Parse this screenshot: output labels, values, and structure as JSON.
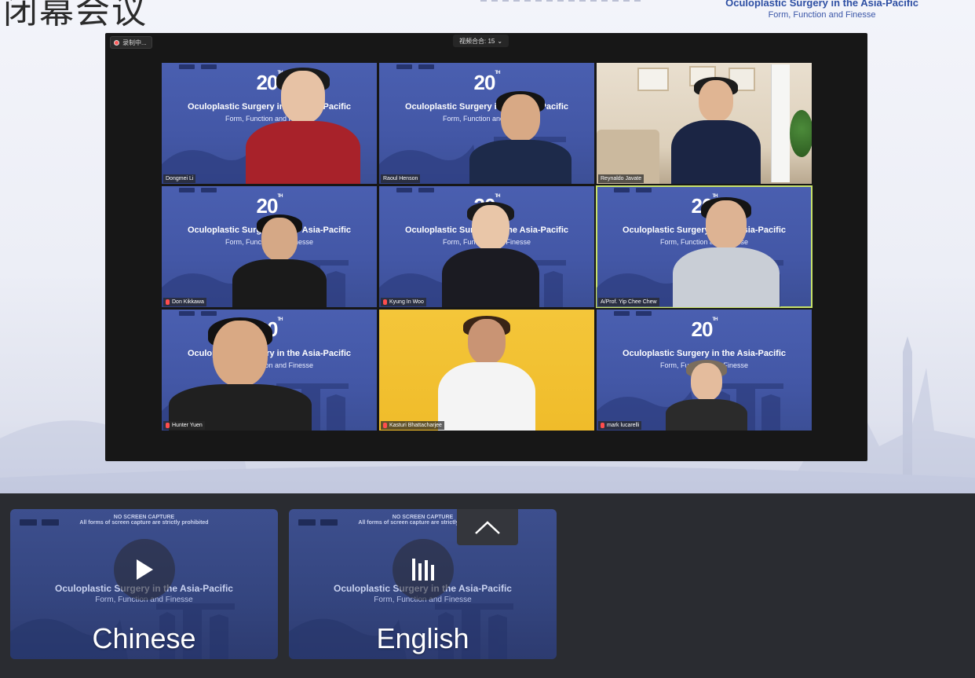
{
  "slide": {
    "title": "闭幕会议",
    "brand_title": "Oculoplastic Surgery in the Asia-Pacific",
    "brand_subtitle": "Form, Function and Finesse"
  },
  "meeting": {
    "recording_label": "录制中...",
    "view_label": "视频合合: 15",
    "slide_title": "Oculoplastic Surgery in the Asia-Pacific",
    "slide_subtitle": "Form, Function and Finesse",
    "anniversary": "20",
    "anniversary_suffix": "TH",
    "participants": [
      {
        "name": "Dongmei Li",
        "muted": false,
        "background": "virtual"
      },
      {
        "name": "Raoul Henson",
        "muted": false,
        "background": "virtual"
      },
      {
        "name": "Reynaldo Javate",
        "muted": false,
        "background": "room"
      },
      {
        "name": "Don Kikkawa",
        "muted": true,
        "background": "virtual"
      },
      {
        "name": "Kyung In Woo",
        "muted": true,
        "background": "virtual"
      },
      {
        "name": "A/Prof. Yip Chee Chew",
        "muted": false,
        "background": "virtual",
        "active_speaker": true
      },
      {
        "name": "Hunter Yuen",
        "muted": true,
        "background": "virtual"
      },
      {
        "name": "Kasturi Bhattacharjee",
        "muted": true,
        "background": "yellow"
      },
      {
        "name": "mark lucarelli",
        "muted": true,
        "background": "virtual"
      }
    ]
  },
  "audio_panel": {
    "notice_title": "NO SCREEN CAPTURE",
    "notice_text": "All forms of screen capture are strictly prohibited",
    "card_title": "Oculoplastic Surgery in the Asia-Pacific",
    "card_subtitle": "Form, Function and Finesse",
    "cards": [
      {
        "language": "Chinese",
        "state": "play-icon"
      },
      {
        "language": "English",
        "state": "audio-playing-icon"
      }
    ],
    "collapse_icon": "chevron-up-icon"
  },
  "colors": {
    "panel_bg": "#2a2c31",
    "tile_blue": "#4a5fb0",
    "active_outline": "#c8e26a",
    "muted_red": "#ff4d4d"
  }
}
